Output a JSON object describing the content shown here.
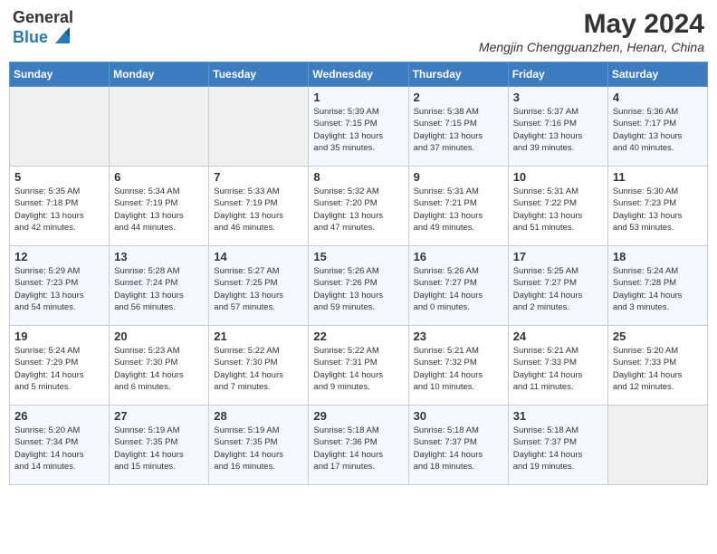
{
  "header": {
    "logo_general": "General",
    "logo_blue": "Blue",
    "month_year": "May 2024",
    "location": "Mengjin Chengguanzhen, Henan, China"
  },
  "weekdays": [
    "Sunday",
    "Monday",
    "Tuesday",
    "Wednesday",
    "Thursday",
    "Friday",
    "Saturday"
  ],
  "weeks": [
    [
      {
        "day": "",
        "info": ""
      },
      {
        "day": "",
        "info": ""
      },
      {
        "day": "",
        "info": ""
      },
      {
        "day": "1",
        "info": "Sunrise: 5:39 AM\nSunset: 7:15 PM\nDaylight: 13 hours\nand 35 minutes."
      },
      {
        "day": "2",
        "info": "Sunrise: 5:38 AM\nSunset: 7:15 PM\nDaylight: 13 hours\nand 37 minutes."
      },
      {
        "day": "3",
        "info": "Sunrise: 5:37 AM\nSunset: 7:16 PM\nDaylight: 13 hours\nand 39 minutes."
      },
      {
        "day": "4",
        "info": "Sunrise: 5:36 AM\nSunset: 7:17 PM\nDaylight: 13 hours\nand 40 minutes."
      }
    ],
    [
      {
        "day": "5",
        "info": "Sunrise: 5:35 AM\nSunset: 7:18 PM\nDaylight: 13 hours\nand 42 minutes."
      },
      {
        "day": "6",
        "info": "Sunrise: 5:34 AM\nSunset: 7:19 PM\nDaylight: 13 hours\nand 44 minutes."
      },
      {
        "day": "7",
        "info": "Sunrise: 5:33 AM\nSunset: 7:19 PM\nDaylight: 13 hours\nand 46 minutes."
      },
      {
        "day": "8",
        "info": "Sunrise: 5:32 AM\nSunset: 7:20 PM\nDaylight: 13 hours\nand 47 minutes."
      },
      {
        "day": "9",
        "info": "Sunrise: 5:31 AM\nSunset: 7:21 PM\nDaylight: 13 hours\nand 49 minutes."
      },
      {
        "day": "10",
        "info": "Sunrise: 5:31 AM\nSunset: 7:22 PM\nDaylight: 13 hours\nand 51 minutes."
      },
      {
        "day": "11",
        "info": "Sunrise: 5:30 AM\nSunset: 7:23 PM\nDaylight: 13 hours\nand 53 minutes."
      }
    ],
    [
      {
        "day": "12",
        "info": "Sunrise: 5:29 AM\nSunset: 7:23 PM\nDaylight: 13 hours\nand 54 minutes."
      },
      {
        "day": "13",
        "info": "Sunrise: 5:28 AM\nSunset: 7:24 PM\nDaylight: 13 hours\nand 56 minutes."
      },
      {
        "day": "14",
        "info": "Sunrise: 5:27 AM\nSunset: 7:25 PM\nDaylight: 13 hours\nand 57 minutes."
      },
      {
        "day": "15",
        "info": "Sunrise: 5:26 AM\nSunset: 7:26 PM\nDaylight: 13 hours\nand 59 minutes."
      },
      {
        "day": "16",
        "info": "Sunrise: 5:26 AM\nSunset: 7:27 PM\nDaylight: 14 hours\nand 0 minutes."
      },
      {
        "day": "17",
        "info": "Sunrise: 5:25 AM\nSunset: 7:27 PM\nDaylight: 14 hours\nand 2 minutes."
      },
      {
        "day": "18",
        "info": "Sunrise: 5:24 AM\nSunset: 7:28 PM\nDaylight: 14 hours\nand 3 minutes."
      }
    ],
    [
      {
        "day": "19",
        "info": "Sunrise: 5:24 AM\nSunset: 7:29 PM\nDaylight: 14 hours\nand 5 minutes."
      },
      {
        "day": "20",
        "info": "Sunrise: 5:23 AM\nSunset: 7:30 PM\nDaylight: 14 hours\nand 6 minutes."
      },
      {
        "day": "21",
        "info": "Sunrise: 5:22 AM\nSunset: 7:30 PM\nDaylight: 14 hours\nand 7 minutes."
      },
      {
        "day": "22",
        "info": "Sunrise: 5:22 AM\nSunset: 7:31 PM\nDaylight: 14 hours\nand 9 minutes."
      },
      {
        "day": "23",
        "info": "Sunrise: 5:21 AM\nSunset: 7:32 PM\nDaylight: 14 hours\nand 10 minutes."
      },
      {
        "day": "24",
        "info": "Sunrise: 5:21 AM\nSunset: 7:33 PM\nDaylight: 14 hours\nand 11 minutes."
      },
      {
        "day": "25",
        "info": "Sunrise: 5:20 AM\nSunset: 7:33 PM\nDaylight: 14 hours\nand 12 minutes."
      }
    ],
    [
      {
        "day": "26",
        "info": "Sunrise: 5:20 AM\nSunset: 7:34 PM\nDaylight: 14 hours\nand 14 minutes."
      },
      {
        "day": "27",
        "info": "Sunrise: 5:19 AM\nSunset: 7:35 PM\nDaylight: 14 hours\nand 15 minutes."
      },
      {
        "day": "28",
        "info": "Sunrise: 5:19 AM\nSunset: 7:35 PM\nDaylight: 14 hours\nand 16 minutes."
      },
      {
        "day": "29",
        "info": "Sunrise: 5:18 AM\nSunset: 7:36 PM\nDaylight: 14 hours\nand 17 minutes."
      },
      {
        "day": "30",
        "info": "Sunrise: 5:18 AM\nSunset: 7:37 PM\nDaylight: 14 hours\nand 18 minutes."
      },
      {
        "day": "31",
        "info": "Sunrise: 5:18 AM\nSunset: 7:37 PM\nDaylight: 14 hours\nand 19 minutes."
      },
      {
        "day": "",
        "info": ""
      }
    ]
  ]
}
